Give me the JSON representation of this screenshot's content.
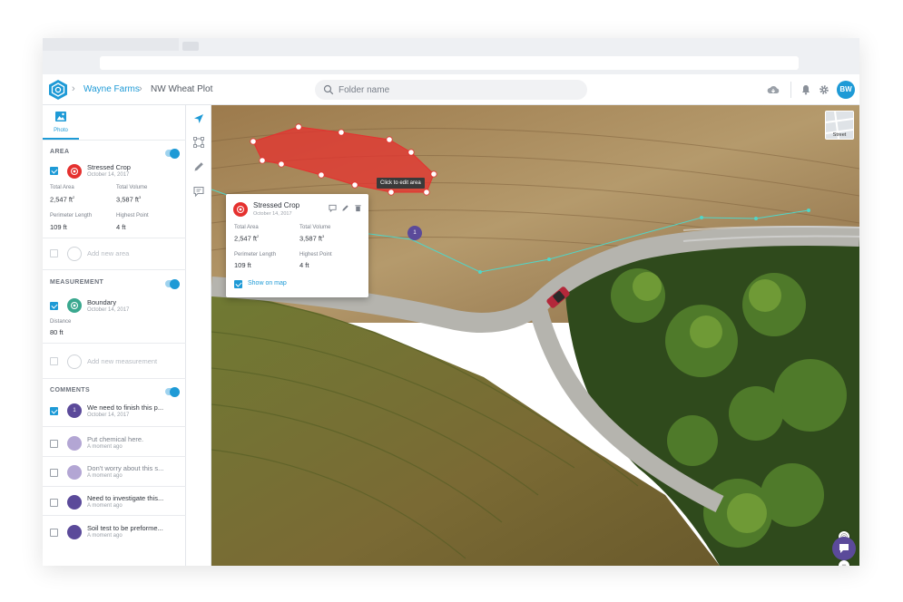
{
  "header": {
    "breadcrumb": [
      "Wayne Farms",
      "NW Wheat Plot"
    ],
    "user_initials": "BW"
  },
  "search": {
    "placeholder": "Folder name",
    "value": ""
  },
  "icons": {
    "logo": "farm-logo-icon",
    "search": "search-icon",
    "cloud": "cloud-download-icon",
    "bell": "bell-icon",
    "settings": "gear-icon",
    "photo": "photo-icon",
    "navigate": "navigate-arrow-icon",
    "area_tool": "polygon-icon",
    "draw_tool": "pencil-icon",
    "comment_tool": "comment-icon"
  },
  "sidebar": {
    "tab_label": "Photo",
    "area": {
      "heading": "AREA",
      "enabled": true,
      "item": {
        "title": "Stressed Crop",
        "date": "October 14, 2017",
        "checked": true
      },
      "stats": [
        {
          "label": "Total Area",
          "value": "2,547 ft",
          "sup": "2"
        },
        {
          "label": "Total Volume",
          "value": "3,587 ft",
          "sup": "3"
        },
        {
          "label": "Perimeter Length",
          "value": "109 ft",
          "sup": ""
        },
        {
          "label": "Highest Point",
          "value": "4 ft",
          "sup": ""
        }
      ],
      "add_label": "Add new area"
    },
    "measurement": {
      "heading": "MEASUREMENT",
      "enabled": true,
      "item": {
        "title": "Boundary",
        "date": "October 14, 2017",
        "checked": true
      },
      "stat": {
        "label": "Distance",
        "value": "80 ft"
      },
      "add_label": "Add new measurement"
    },
    "comments": {
      "heading": "COMMENTS",
      "enabled": true,
      "items": [
        {
          "badge": "1",
          "title": "We need to finish this p...",
          "date": "October 14, 2017",
          "checked": true,
          "color": "#5b4a9a",
          "muted": false
        },
        {
          "badge": "",
          "title": "Put chemical here.",
          "date": "A moment ago",
          "checked": false,
          "color": "#b3a6d4",
          "muted": true
        },
        {
          "badge": "",
          "title": "Don't worry about this s...",
          "date": "A moment ago",
          "checked": false,
          "color": "#b3a6d4",
          "muted": true
        },
        {
          "badge": "",
          "title": "Need to investigate this...",
          "date": "A moment ago",
          "checked": false,
          "color": "#5b4a9a",
          "muted": false
        },
        {
          "badge": "",
          "title": "Soil test to be preforme...",
          "date": "A moment ago",
          "checked": false,
          "color": "#5b4a9a",
          "muted": false
        }
      ]
    }
  },
  "map": {
    "tooltip": "Click to edit area",
    "street_label": "Street",
    "marker_label": "1",
    "popup": {
      "title": "Stressed Crop",
      "date": "October 14, 2017",
      "stats": [
        {
          "label": "Total Area",
          "value": "2,547 ft",
          "sup": "2"
        },
        {
          "label": "Total Volume",
          "value": "3,587 ft",
          "sup": "3"
        },
        {
          "label": "Perimeter Length",
          "value": "109 ft",
          "sup": ""
        },
        {
          "label": "Highest Point",
          "value": "4 ft",
          "sup": ""
        }
      ],
      "show_on_map": "Show on map",
      "show_checked": true
    }
  },
  "colors": {
    "accent": "#1e9ad6",
    "area_red": "#e5312f",
    "measurement_teal": "#3aa88f",
    "comment_purple": "#5b4a9a"
  }
}
